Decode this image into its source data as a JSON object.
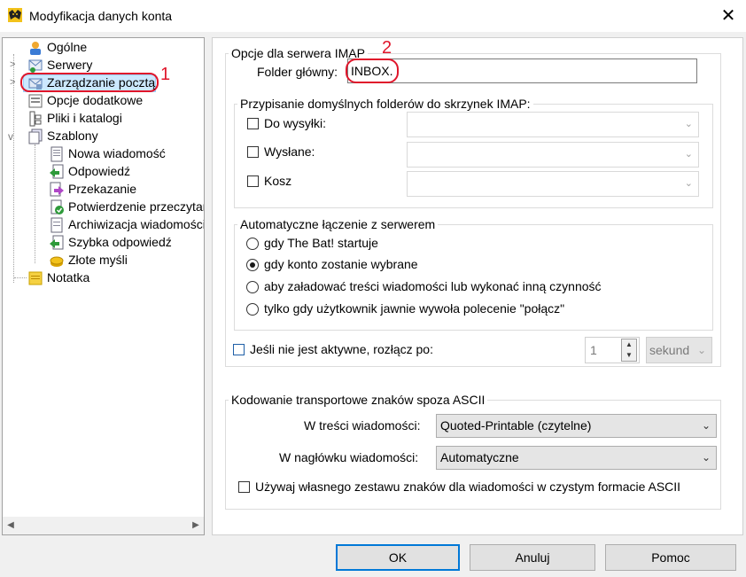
{
  "window": {
    "title": "Modyfikacja danych konta",
    "close_symbol": "✕"
  },
  "tree": {
    "items": [
      {
        "label": "Ogólne",
        "icon": "general-icon"
      },
      {
        "label": "Serwery",
        "icon": "servers-icon"
      },
      {
        "label": "Zarządzanie pocztą",
        "icon": "mail-management-icon"
      },
      {
        "label": "Opcje dodatkowe",
        "icon": "additional-options-icon"
      },
      {
        "label": "Pliki i katalogi",
        "icon": "files-icon"
      },
      {
        "label": "Szablony",
        "icon": "templates-icon"
      },
      {
        "label": "Nowa wiadomość",
        "icon": "new-message-icon"
      },
      {
        "label": "Odpowiedź",
        "icon": "reply-icon"
      },
      {
        "label": "Przekazanie",
        "icon": "forward-icon"
      },
      {
        "label": "Potwierdzenie przeczytar",
        "icon": "read-confirmation-icon"
      },
      {
        "label": "Archiwizacja wiadomości",
        "icon": "archive-icon"
      },
      {
        "label": "Szybka odpowiedź",
        "icon": "quick-reply-icon"
      },
      {
        "label": "Złote myśli",
        "icon": "golden-thoughts-icon"
      },
      {
        "label": "Notatka",
        "icon": "note-icon"
      }
    ],
    "annotation_1": "1"
  },
  "imap": {
    "legend": "Opcje dla serwera IMAP",
    "root_folder_label": "Folder główny:",
    "root_folder_value": "INBOX.",
    "annotation_2": "2"
  },
  "folders": {
    "legend": "Przypisanie domyślnych folderów do skrzynek IMAP:",
    "outbox_label": "Do wysyłki:",
    "sent_label": "Wysłane:",
    "trash_label": "Kosz"
  },
  "auto_connect": {
    "legend": "Automatyczne łączenie z serwerem",
    "options": [
      "gdy The Bat! startuje",
      "gdy konto zostanie wybrane",
      "aby załadować treści wiadomości lub wykonać inną czynność",
      "tylko gdy użytkownik jawnie wywoła polecenie \"połącz\""
    ],
    "selected_index": 1
  },
  "disconnect": {
    "label": "Jeśli nie jest aktywne, rozłącz po:",
    "value": "1",
    "unit": "sekund"
  },
  "encoding": {
    "legend": "Kodowanie transportowe znaków spoza ASCII",
    "body_label": "W treści wiadomości:",
    "body_value": "Quoted-Printable (czytelne)",
    "header_label": "W nagłówku wiadomości:",
    "header_value": "Automatyczne",
    "custom_charset_label": "Używaj własnego zestawu znaków dla wiadomości w czystym formacie ASCII"
  },
  "buttons": {
    "ok": "OK",
    "cancel": "Anuluj",
    "help": "Pomoc"
  }
}
